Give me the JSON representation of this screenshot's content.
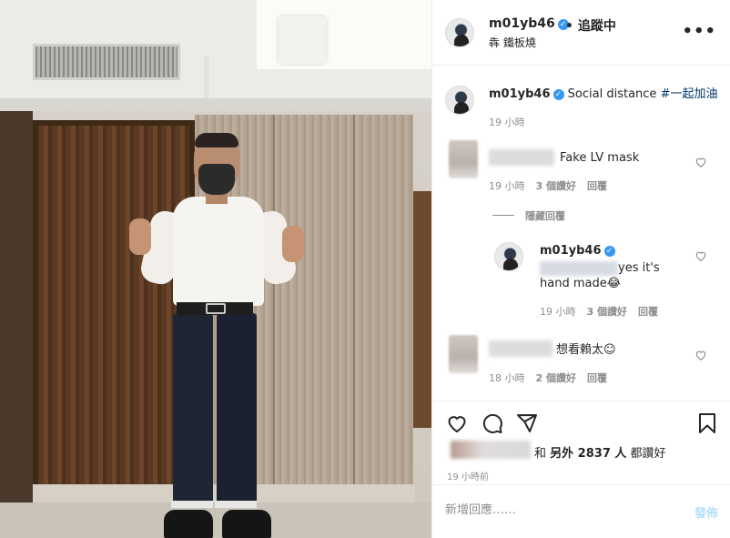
{
  "header": {
    "username": "m01yb46",
    "follow_status": "• 追蹤中",
    "location": "犇 鐵板燒",
    "more_icon": "ellipsis-icon"
  },
  "caption": {
    "username": "m01yb46",
    "text": "Social distance ",
    "hashtag": "#一起加油",
    "time": "19 小時"
  },
  "comments": [
    {
      "text": "Fake LV mask",
      "time": "19 小時",
      "likes": "3 個讚好",
      "reply_label": "回覆",
      "view_replies": "隱藏回覆"
    },
    {
      "username": "m01yb46",
      "text_line1": "yes it's",
      "text_line2": "hand made😂",
      "time": "19 小時",
      "likes": "3 個讚好",
      "reply_label": "回覆"
    },
    {
      "text": "想看賴太☺",
      "time": "18 小時",
      "likes": "2 個讚好",
      "reply_label": "回覆"
    }
  ],
  "likes_summary": {
    "prefix": "和",
    "text": "另外 2837 人",
    "suffix": "都讚好"
  },
  "post_time": "19 小時前",
  "add_comment": {
    "placeholder": "新增回應……",
    "post_label": "發佈"
  },
  "colors": {
    "verified": "#3897f0",
    "hashtag": "#00376b",
    "post_button": "#b2dffc"
  }
}
